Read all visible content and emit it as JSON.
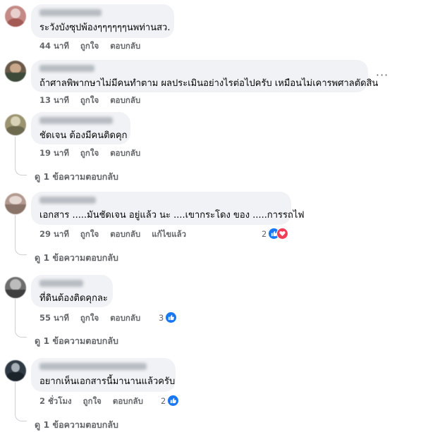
{
  "comments": [
    {
      "text": "ระวังบังซุปพ้องๆๆๆๆๆๆนพท่านสว.",
      "actions": {
        "time": "44 นาที",
        "like": "ถูกใจ",
        "reply": "ตอบกลับ"
      },
      "colors": [
        "#c48a85",
        "#e8d0cd",
        "#a45a55"
      ]
    },
    {
      "text": "ถ้าศาลพิพากษาไม่มีคนทำตาม ผลประเมินอย่างไรต่อไปครับ เหมือนไม่เคารพศาลตัดสิน",
      "actions": {
        "time": "13 นาที",
        "like": "ถูกใจ",
        "reply": "ตอบกลับ"
      },
      "more_icon": "more-horizontal-icon",
      "colors": [
        "#6a5a4a",
        "#c9a78a",
        "#3d4a3a"
      ]
    },
    {
      "text": "ชัดเจน ต้องมีคนติดคุก",
      "actions": {
        "time": "19 นาที",
        "like": "ถูกใจ",
        "reply": "ตอบกลับ"
      },
      "view_replies": "ดู 1 ข้อความตอบกลับ",
      "colors": [
        "#9c9470",
        "#d8d2b6",
        "#6d6a50"
      ]
    },
    {
      "text": "เอกสาร .....มันชัดเจน อยู่แล้ว นะ ....เขากระโดง ของ .....การรถไฟ",
      "actions": {
        "time": "29 นาที",
        "like": "ถูกใจ",
        "reply": "ตอบกลับ",
        "edited": "แก้ไขแล้ว"
      },
      "reactions": {
        "count": "2",
        "icons": [
          "like-icon",
          "love-icon"
        ]
      },
      "view_replies": "ดู 1 ข้อความตอบกลับ",
      "colors": [
        "#b39a90",
        "#e6d8d2",
        "#8a7469"
      ]
    },
    {
      "text": "ที่ดินต้องติดคุกละ",
      "actions": {
        "time": "55 นาที",
        "like": "ถูกใจ",
        "reply": "ตอบกลับ"
      },
      "reactions": {
        "count": "3",
        "icons": [
          "like-icon"
        ]
      },
      "view_replies": "ดู 1 ข้อความตอบกลับ",
      "colors": [
        "#6e6e6e",
        "#bcbcbc",
        "#3f3f3f"
      ]
    },
    {
      "text": "อยากเห็นเอกสารนี้มานานแล้วครับ",
      "actions": {
        "time": "2 ชั่วโมง",
        "like": "ถูกใจ",
        "reply": "ตอบกลับ"
      },
      "reactions": {
        "count": "2",
        "icons": [
          "like-icon"
        ]
      },
      "view_replies": "ดู 1 ข้อความตอบกลับ",
      "colors": [
        "#2f3a44",
        "#a7b0b6",
        "#1c242b"
      ]
    }
  ]
}
